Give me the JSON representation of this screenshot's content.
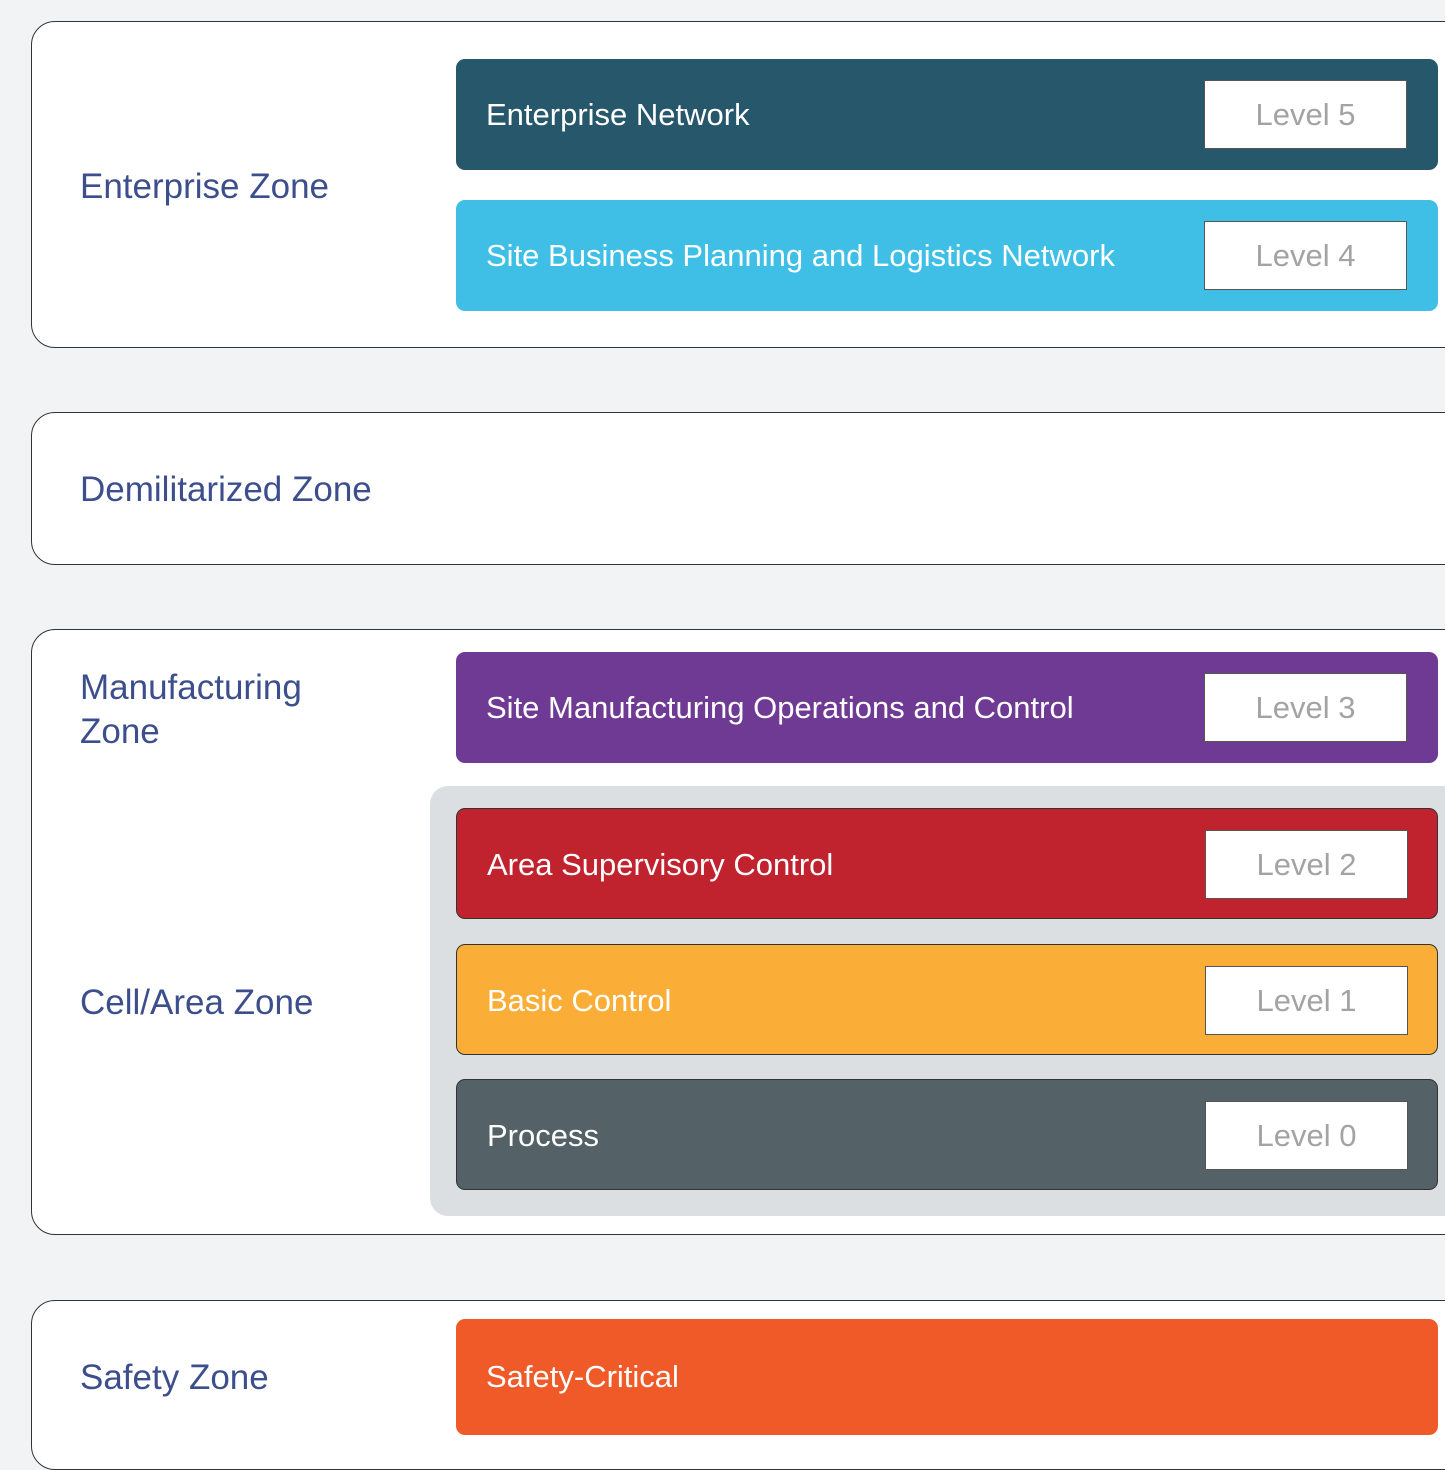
{
  "zones": {
    "enterprise": {
      "label": "Enterprise Zone"
    },
    "dmz": {
      "label": "Demilitarized Zone"
    },
    "manufacturing": {
      "label": "Manufacturing Zone"
    },
    "cell_area": {
      "label": "Cell/Area Zone"
    },
    "safety": {
      "label": "Safety Zone"
    }
  },
  "levels": [
    {
      "name": "Enterprise Network",
      "level": "Level 5",
      "color": "#26576b"
    },
    {
      "name": "Site Business Planning and Logistics Network",
      "level": "Level 4",
      "color": "#3fbfe6"
    },
    {
      "name": "Site Manufacturing Operations and Control",
      "level": "Level 3",
      "color": "#6e3a93"
    },
    {
      "name": "Area Supervisory Control",
      "level": "Level 2",
      "color": "#c0232e"
    },
    {
      "name": "Basic Control",
      "level": "Level 1",
      "color": "#faae37"
    },
    {
      "name": "Process",
      "level": "Level 0",
      "color": "#546268"
    }
  ],
  "safety_band": {
    "name": "Safety-Critical",
    "color": "#f05a28"
  }
}
